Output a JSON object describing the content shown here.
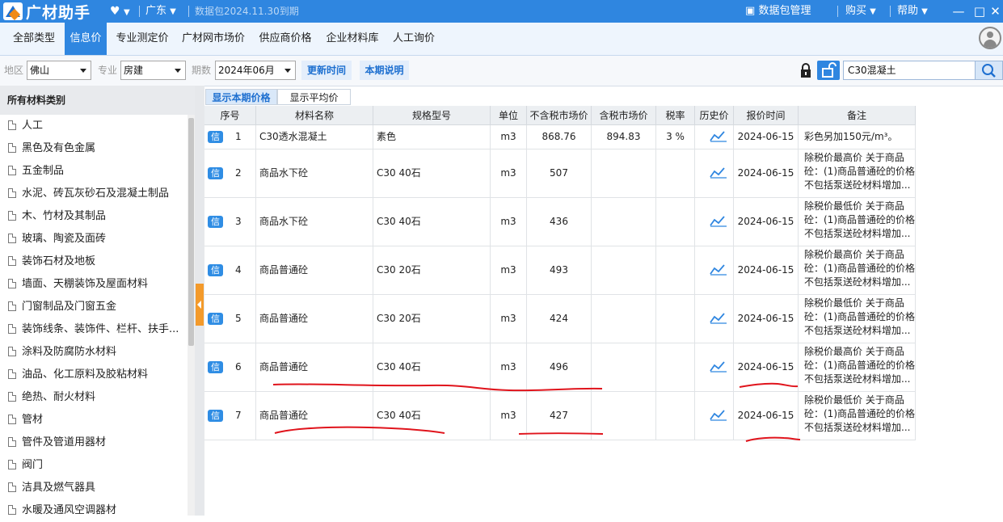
{
  "app": {
    "name": "广材助手",
    "region": "广东",
    "data_package": "数据包2024.11.30到期",
    "menu": {
      "data_pkg": "数据包管理",
      "buy": "购买",
      "help": "帮助"
    }
  },
  "tabs": [
    "全部类型",
    "信息价",
    "专业测定价",
    "广材网市场价",
    "供应商价格",
    "企业材料库",
    "人工询价"
  ],
  "filters": {
    "area_label": "地区",
    "area_value": "佛山",
    "major_label": "专业",
    "major_value": "房建",
    "period_label": "期数",
    "period_value": "2024年06月",
    "update_btn": "更新时间",
    "explain_btn": "本期说明",
    "search_value": "C30混凝土"
  },
  "sidebar": {
    "title": "所有材料类别",
    "items": [
      "人工",
      "黑色及有色金属",
      "五金制品",
      "水泥、砖瓦灰砂石及混凝土制品",
      "木、竹材及其制品",
      "玻璃、陶瓷及面砖",
      "装饰石材及地板",
      "墙面、天棚装饰及屋面材料",
      "门窗制品及门窗五金",
      "装饰线条、装饰件、栏杆、扶手...",
      "涂料及防腐防水材料",
      "油品、化工原料及胶粘材料",
      "绝热、耐火材料",
      "管材",
      "管件及管道用器材",
      "阀门",
      "洁具及燃气器具",
      "水暖及通风空调器材"
    ]
  },
  "subtabs": {
    "current": "显示本期价格",
    "average": "显示平均价"
  },
  "table": {
    "headers": [
      "序号",
      "材料名称",
      "规格型号",
      "单位",
      "不含税市场价",
      "含税市场价",
      "税率",
      "历史价",
      "报价时间",
      "备注"
    ],
    "badge": "信",
    "rows": [
      {
        "no": "1",
        "name": "C30透水混凝土",
        "spec": "素色",
        "unit": "m3",
        "price_ex": "868.76",
        "price_in": "894.83",
        "tax": "3 %",
        "date": "2024-06-15",
        "remark": "彩色另加150元/m³。"
      },
      {
        "no": "2",
        "name": "商品水下砼",
        "spec": "C30 40石",
        "unit": "m3",
        "price_ex": "507",
        "price_in": "",
        "tax": "",
        "date": "2024-06-15",
        "remark": "除税价最高价 关于商品砼：(1)商品普通砼的价格不包括泵送砼材料增加..."
      },
      {
        "no": "3",
        "name": "商品水下砼",
        "spec": "C30 40石",
        "unit": "m3",
        "price_ex": "436",
        "price_in": "",
        "tax": "",
        "date": "2024-06-15",
        "remark": "除税价最低价 关于商品砼：(1)商品普通砼的价格不包括泵送砼材料增加..."
      },
      {
        "no": "4",
        "name": "商品普通砼",
        "spec": "C30 20石",
        "unit": "m3",
        "price_ex": "493",
        "price_in": "",
        "tax": "",
        "date": "2024-06-15",
        "remark": "除税价最高价 关于商品砼：(1)商品普通砼的价格不包括泵送砼材料增加..."
      },
      {
        "no": "5",
        "name": "商品普通砼",
        "spec": "C30 20石",
        "unit": "m3",
        "price_ex": "424",
        "price_in": "",
        "tax": "",
        "date": "2024-06-15",
        "remark": "除税价最低价 关于商品砼：(1)商品普通砼的价格不包括泵送砼材料增加..."
      },
      {
        "no": "6",
        "name": "商品普通砼",
        "spec": "C30 40石",
        "unit": "m3",
        "price_ex": "496",
        "price_in": "",
        "tax": "",
        "date": "2024-06-15",
        "remark": "除税价最高价 关于商品砼：(1)商品普通砼的价格不包括泵送砼材料增加..."
      },
      {
        "no": "7",
        "name": "商品普通砼",
        "spec": "C30 40石",
        "unit": "m3",
        "price_ex": "427",
        "price_in": "",
        "tax": "",
        "date": "2024-06-15",
        "remark": "除税价最低价 关于商品砼：(1)商品普通砼的价格不包括泵送砼材料增加..."
      }
    ]
  },
  "colors": {
    "primary": "#2f86e0",
    "accent": "#f39a2b",
    "annotation": "#e0141c"
  }
}
